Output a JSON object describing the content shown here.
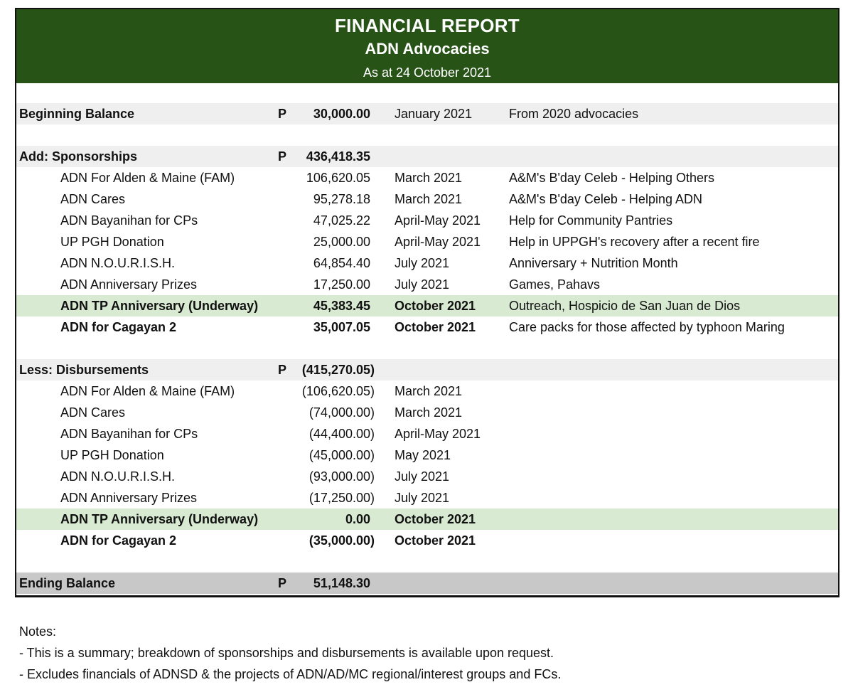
{
  "header": {
    "title": "FINANCIAL REPORT",
    "subtitle": "ADN Advocacies",
    "asof": "As at 24 October 2021"
  },
  "beginning": {
    "label": "Beginning Balance",
    "currency": "P",
    "amount": "30,000.00",
    "date": "January 2021",
    "note": "From 2020  advocacies"
  },
  "sponsorships": {
    "label": "Add:  Sponsorships",
    "currency": "P",
    "total": "436,418.35",
    "items": [
      {
        "name": "ADN For Alden & Maine (FAM)",
        "amount": "106,620.05",
        "date": "March 2021",
        "note": "A&M's B'day Celeb - Helping Others"
      },
      {
        "name": "ADN Cares",
        "amount": "95,278.18",
        "date": "March 2021",
        "note": "A&M's B'day Celeb - Helping ADN"
      },
      {
        "name": "ADN Bayanihan for CPs",
        "amount": "47,025.22",
        "date": "April-May 2021",
        "note": "Help for Community Pantries"
      },
      {
        "name": "UP PGH Donation",
        "amount": "25,000.00",
        "date": "April-May 2021",
        "note": "Help in UPPGH's recovery after a recent fire"
      },
      {
        "name": "ADN N.O.U.R.I.S.H.",
        "amount": "64,854.40",
        "date": "July 2021",
        "note": "Anniversary + Nutrition Month"
      },
      {
        "name": "ADN Anniversary Prizes",
        "amount": "17,250.00",
        "date": "July 2021",
        "note": "Games, Pahavs"
      },
      {
        "name": "ADN TP Anniversary (Underway)",
        "amount": "45,383.45",
        "date": "October 2021",
        "note": "Outreach, Hospicio de San Juan de Dios"
      },
      {
        "name": "ADN for Cagayan 2",
        "amount": "35,007.05",
        "date": "October 2021",
        "note": "Care packs for those affected by typhoon Maring"
      }
    ]
  },
  "disbursements": {
    "label": "Less: Disbursements",
    "currency": "P",
    "total": "(415,270.05)",
    "items": [
      {
        "name": "ADN For Alden & Maine (FAM)",
        "amount": "(106,620.05)",
        "date": "March 2021"
      },
      {
        "name": "ADN Cares",
        "amount": "(74,000.00)",
        "date": "March 2021"
      },
      {
        "name": "ADN Bayanihan for CPs",
        "amount": "(44,400.00)",
        "date": "April-May 2021"
      },
      {
        "name": "UP PGH Donation",
        "amount": "(45,000.00)",
        "date": "May 2021"
      },
      {
        "name": "ADN N.O.U.R.I.S.H.",
        "amount": "(93,000.00)",
        "date": "July 2021"
      },
      {
        "name": "ADN Anniversary Prizes",
        "amount": "(17,250.00)",
        "date": "July 2021"
      },
      {
        "name": "ADN TP Anniversary (Underway)",
        "amount": "0.00",
        "date": "October 2021"
      },
      {
        "name": "ADN for Cagayan 2",
        "amount": "(35,000.00)",
        "date": "October 2021"
      }
    ]
  },
  "ending": {
    "label": "Ending Balance",
    "currency": "P",
    "amount": "51,148.30"
  },
  "notes": {
    "heading": "Notes:",
    "lines": [
      "- This is a summary; breakdown of sponsorships and disbursements is available upon request.",
      "- Excludes financials of ADNSD & the projects of ADN/AD/MC regional/interest groups and FCs."
    ]
  },
  "colors": {
    "header_bg": "#275317",
    "highlight_row": "#d9ead3",
    "section_row": "#efefef",
    "ending_row": "#c8c8c8"
  }
}
